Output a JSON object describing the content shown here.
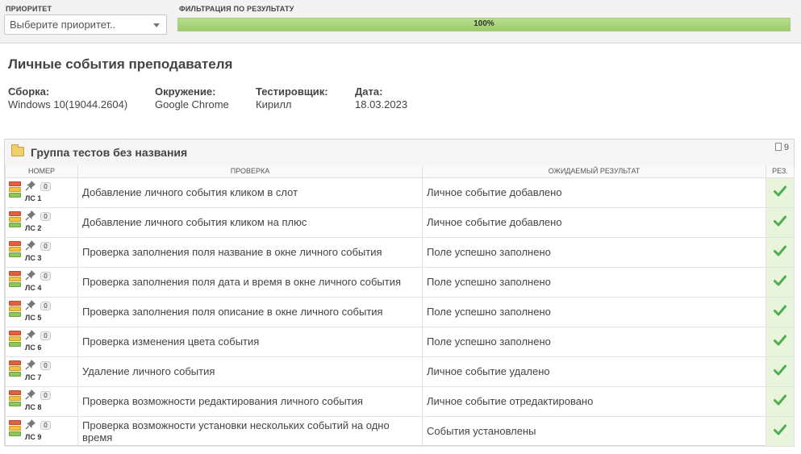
{
  "filters": {
    "priority_label": "ПРИОРИТЕТ",
    "priority_placeholder": "Выберите приоритет..",
    "result_label": "ФИЛЬТРАЦИЯ ПО РЕЗУЛЬТАТУ",
    "progress_text": "100%",
    "progress_value": 1.0
  },
  "page_title": "Личные события преподавателя",
  "meta": {
    "build_label": "Сборка:",
    "build_value": "Windows 10(19044.2604)",
    "env_label": "Окружение:",
    "env_value": "Google Chrome",
    "tester_label": "Тестировщик:",
    "tester_value": "Кирилл",
    "date_label": "Дата:",
    "date_value": "18.03.2023"
  },
  "group": {
    "title": "Группа тестов без названия",
    "count": "9",
    "columns": {
      "number": "НОМЕР",
      "check": "ПРОВЕРКА",
      "expected": "ОЖИДАЕМЫЙ РЕЗУЛЬТАТ",
      "result": "РЕЗ."
    },
    "rows": [
      {
        "id": "ЛС 1",
        "badge": "0",
        "check": "Добавление личного события кликом в слот",
        "expected": "Личное событие добавлено",
        "result": "passed"
      },
      {
        "id": "ЛС 2",
        "badge": "0",
        "check": "Добавление личного события кликом на плюс",
        "expected": "Личное событие добавлено",
        "result": "passed"
      },
      {
        "id": "ЛС 3",
        "badge": "0",
        "check": "Проверка заполнения поля название в окне личного события",
        "expected": "Поле успешно заполнено",
        "result": "passed"
      },
      {
        "id": "ЛС 4",
        "badge": "0",
        "check": "Проверка заполнения поля дата и время в окне личного события",
        "expected": "Поле успешно заполнено",
        "result": "passed"
      },
      {
        "id": "ЛС 5",
        "badge": "0",
        "check": "Проверка заполнения поля описание в окне личного события",
        "expected": "Поле успешно заполнено",
        "result": "passed"
      },
      {
        "id": "ЛС 6",
        "badge": "0",
        "check": "Проверка изменения цвета события",
        "expected": "Поле успешно заполнено",
        "result": "passed"
      },
      {
        "id": "ЛС 7",
        "badge": "0",
        "check": "Удаление личного события",
        "expected": "Личное событие удалено",
        "result": "passed"
      },
      {
        "id": "ЛС 8",
        "badge": "0",
        "check": "Проверка возможности редактирования личного события",
        "expected": "Личное событие отредактировано",
        "result": "passed"
      },
      {
        "id": "ЛС 9",
        "badge": "0",
        "check": "Проверка возможности установки нескольких событий на одно время",
        "expected": "События установлены",
        "result": "passed"
      }
    ]
  },
  "colors": {
    "pass_green": "#4caf50",
    "result_bg": "#e8f5dc",
    "progress_green": "#9ccd6b"
  }
}
